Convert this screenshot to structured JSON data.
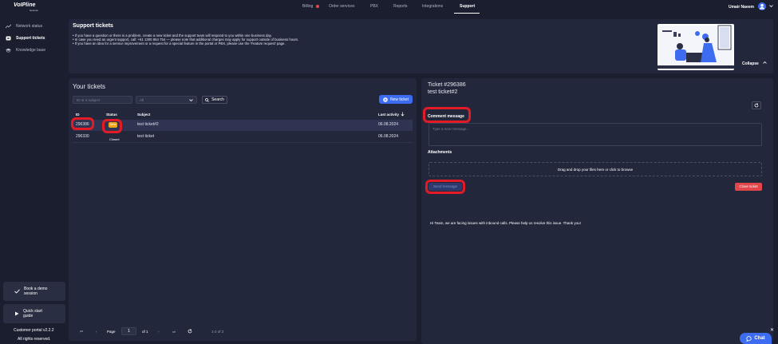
{
  "brand": {
    "name": "VoIPline",
    "tagline": "Network"
  },
  "nav": {
    "items": [
      {
        "label": "Billing",
        "active": false,
        "alert": true
      },
      {
        "label": "Order services",
        "active": false
      },
      {
        "label": "PBX",
        "active": false
      },
      {
        "label": "Reports",
        "active": false
      },
      {
        "label": "Integrations",
        "active": false
      },
      {
        "label": "Support",
        "active": true
      }
    ],
    "user_name": "Umair Naeem"
  },
  "sidebar": {
    "items": [
      {
        "label": "Network status",
        "icon": "chart-line-icon",
        "active": false
      },
      {
        "label": "Support tickets",
        "icon": "ticket-icon",
        "active": true
      },
      {
        "label": "Knowledge base",
        "icon": "graduation-cap-icon",
        "active": false
      }
    ],
    "demo_card": {
      "line1": "Book a demo",
      "line2": "session"
    },
    "guide_card": {
      "line1": "Quick start",
      "line2": "guide"
    },
    "version": "Customer portal v2.2.2",
    "rights": "All rights reserved."
  },
  "banner": {
    "title": "Support tickets",
    "lines": [
      "If you have a question or there is a problem, create a new ticket and the support team will respond to you within one business day.",
      "In case you need an urgent support, call: +61 1300 864 754 — please note that additional charges may apply for support outside of business hours.",
      "If you have an idea for a service improvement or a request for a special feature in the portal or PBX, please use the 'Feature request' page."
    ],
    "collapse_label": "Collapse"
  },
  "tickets": {
    "title": "Your tickets",
    "search_placeholder": "ID or a subject",
    "status_filter": "All",
    "search_label": "Search",
    "new_ticket_label": "New ticket",
    "columns": {
      "id": "ID",
      "status": "Status",
      "subject": "Subject",
      "last_activity": "Last activity"
    },
    "rows": [
      {
        "id": "296386",
        "status": "New",
        "subject": "test ticket#2",
        "last_activity": "06.08.2024",
        "selected": true
      },
      {
        "id": "296330",
        "status": "Closed",
        "subject": "test ticket",
        "last_activity": "06.08.2024",
        "selected": false
      }
    ],
    "pager": {
      "page_label": "Page",
      "page": "1",
      "of_label": "of 1",
      "range": "1-2 of 2"
    }
  },
  "detail": {
    "ticket_id": "Ticket #296386",
    "subject": "test ticket#2",
    "comment_label": "Comment message",
    "comment_placeholder": "Type a new message...",
    "attachments_label": "Attachments",
    "dropzone_text": "Drag and drop your files here or click to browse",
    "send_label": "Send message",
    "close_label": "Close ticket",
    "message": "Hi Team, we are facing issues with inbound calls. Please help us resolve this issue. Thank you!"
  },
  "chat": {
    "label": "Chat"
  },
  "colors": {
    "accent": "#3d6cf0",
    "danger": "#e2464a",
    "new_badge": "#f0a418",
    "highlight": "#e21b26"
  }
}
